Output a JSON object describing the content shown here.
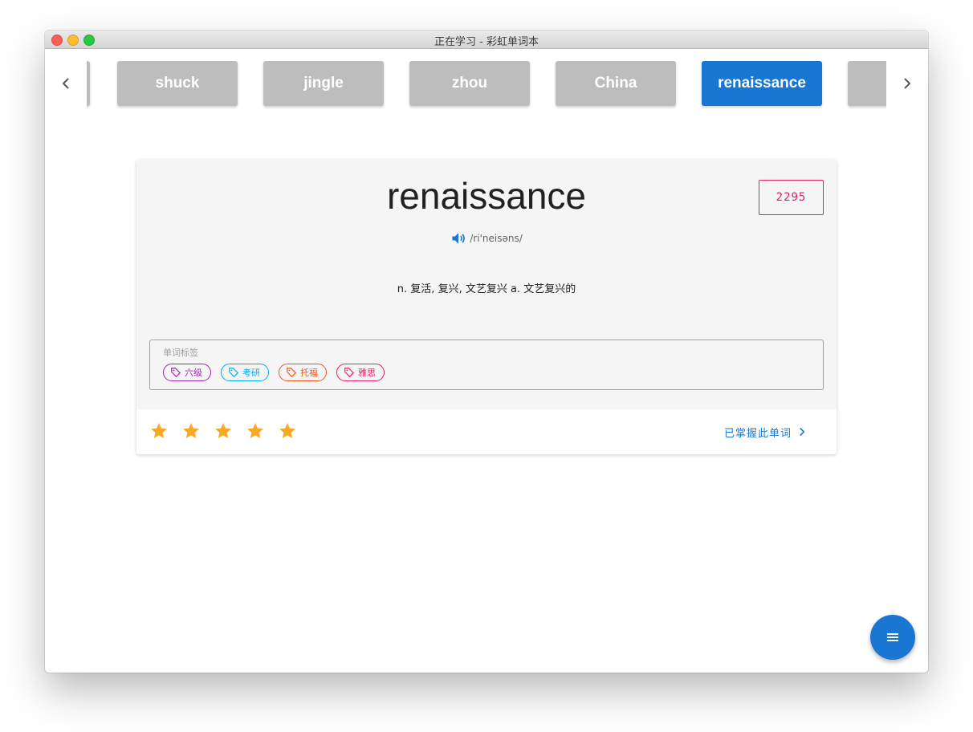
{
  "window": {
    "title": "正在学习 - 彩虹单词本"
  },
  "nav": {
    "prev_icon": "chevron-left-icon",
    "next_icon": "chevron-right-icon"
  },
  "word_strip": {
    "words": [
      "",
      "shuck",
      "jingle",
      "zhou",
      "China",
      "renaissance",
      ""
    ],
    "active_index": 5
  },
  "card": {
    "word": "renaissance",
    "count": "2295",
    "phonetic": "/ri'neisəns/",
    "meaning": "n. 复活, 复兴, 文艺复兴 a. 文艺复兴的",
    "tags_label": "单词标签",
    "tags": [
      {
        "label": "六级",
        "color": "#9c27b0"
      },
      {
        "label": "考研",
        "color": "#03a9f4"
      },
      {
        "label": "托福",
        "color": "#f4511e"
      },
      {
        "label": "雅思",
        "color": "#e91e63"
      }
    ],
    "rating": {
      "value": 5,
      "max": 5
    },
    "star_color": "#f9a825",
    "mastered_label": "已掌握此单词"
  },
  "colors": {
    "accent": "#1976d2",
    "chip_inactive": "#bdbdbd"
  },
  "fab_icon": "menu-icon"
}
